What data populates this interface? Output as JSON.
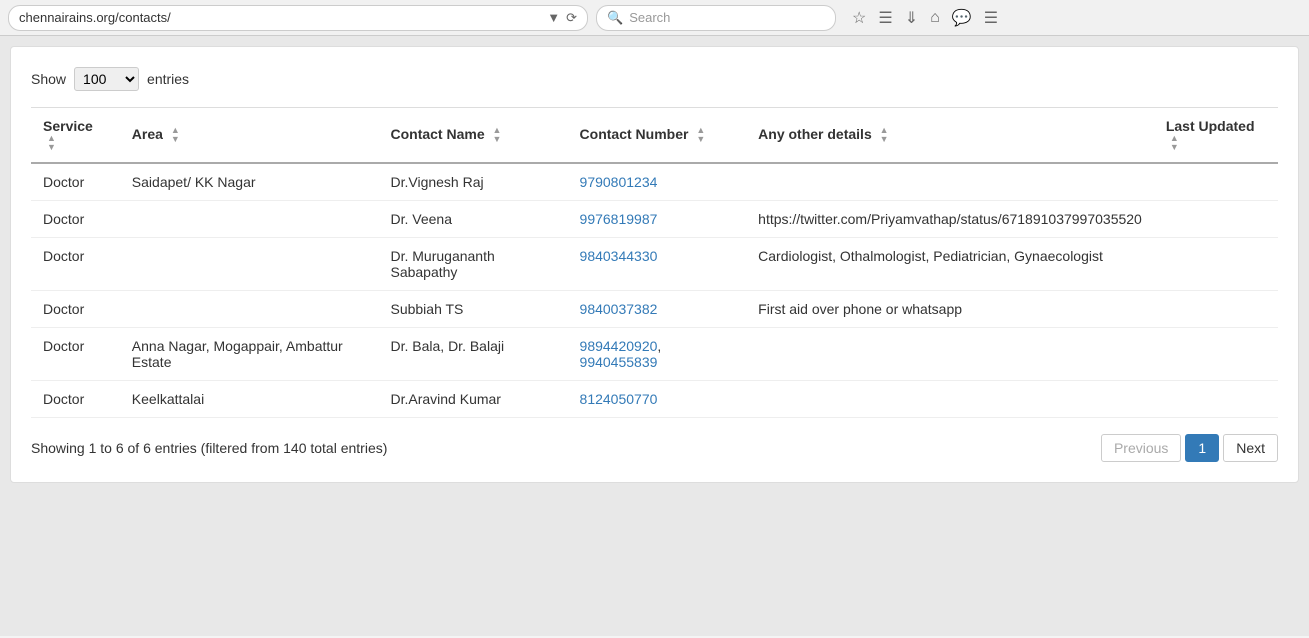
{
  "browser": {
    "url": "chennairains.org/contacts/",
    "search_placeholder": "Search"
  },
  "show_entries": {
    "label_show": "Show",
    "value": "100",
    "label_entries": "entries"
  },
  "table": {
    "columns": [
      {
        "key": "service",
        "label": "Service"
      },
      {
        "key": "area",
        "label": "Area"
      },
      {
        "key": "contact_name",
        "label": "Contact Name"
      },
      {
        "key": "contact_number",
        "label": "Contact Number"
      },
      {
        "key": "other_details",
        "label": "Any other details"
      },
      {
        "key": "last_updated",
        "label": "Last Updated"
      }
    ],
    "rows": [
      {
        "service": "Doctor",
        "area": "Saidapet/ KK Nagar",
        "contact_name": "Dr.Vignesh Raj",
        "contact_number": "9790801234",
        "other_details": "",
        "last_updated": ""
      },
      {
        "service": "Doctor",
        "area": "",
        "contact_name": "Dr. Veena",
        "contact_number": "9976819987",
        "other_details": "https://twitter.com/Priyamvathap/status/671891037997035520",
        "last_updated": ""
      },
      {
        "service": "Doctor",
        "area": "",
        "contact_name": "Dr. Murugananth Sabapathy",
        "contact_number": "9840344330",
        "other_details": "Cardiologist, Othalmologist, Pediatrician, Gynaecologist",
        "last_updated": ""
      },
      {
        "service": "Doctor",
        "area": "",
        "contact_name": "Subbiah TS",
        "contact_number": "9840037382",
        "other_details": "First aid over phone or whatsapp",
        "last_updated": ""
      },
      {
        "service": "Doctor",
        "area": "Anna Nagar, Mogappair, Ambattur Estate",
        "contact_name": "Dr. Bala, Dr. Balaji",
        "contact_number": "9894420920, 9940455839",
        "other_details": "",
        "last_updated": ""
      },
      {
        "service": "Doctor",
        "area": "Keelkattalai",
        "contact_name": "Dr.Aravind Kumar",
        "contact_number": "8124050770",
        "other_details": "",
        "last_updated": ""
      }
    ]
  },
  "pagination": {
    "showing_text": "Showing 1 to 6 of 6 entries (filtered from 140 total entries)",
    "previous_label": "Previous",
    "current_page": "1",
    "next_label": "Next"
  }
}
